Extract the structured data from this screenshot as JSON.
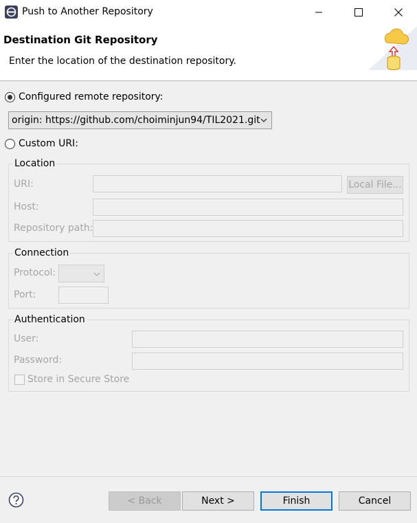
{
  "window": {
    "title": "Push to Another Repository"
  },
  "header": {
    "title": "Destination Git Repository",
    "description": "Enter the location of the destination repository."
  },
  "configured": {
    "label": "Configured remote repository:",
    "selected": true,
    "value": "origin: https://github.com/choiminjun94/TIL2021.git"
  },
  "custom": {
    "label": "Custom URI:",
    "selected": false
  },
  "location": {
    "title": "Location",
    "uri_label": "URI:",
    "uri_value": "",
    "local_file_label": "Local File...",
    "host_label": "Host:",
    "host_value": "",
    "path_label": "Repository path:",
    "path_value": ""
  },
  "connection": {
    "title": "Connection",
    "protocol_label": "Protocol:",
    "protocol_value": "",
    "port_label": "Port:",
    "port_value": ""
  },
  "authentication": {
    "title": "Authentication",
    "user_label": "User:",
    "user_value": "",
    "password_label": "Password:",
    "password_value": "",
    "store_label": "Store in Secure Store",
    "store_checked": false
  },
  "footer": {
    "back_label": "< Back",
    "next_label": "Next >",
    "finish_label": "Finish",
    "cancel_label": "Cancel"
  },
  "colors": {
    "default_button_border": "#0078d7",
    "dialog_bg": "#f0f0f0"
  },
  "icons": [
    "eclipse-app-icon",
    "minimize-icon",
    "maximize-icon",
    "close-icon",
    "git-push-wizard-icon",
    "chevron-down-icon",
    "help-icon"
  ]
}
